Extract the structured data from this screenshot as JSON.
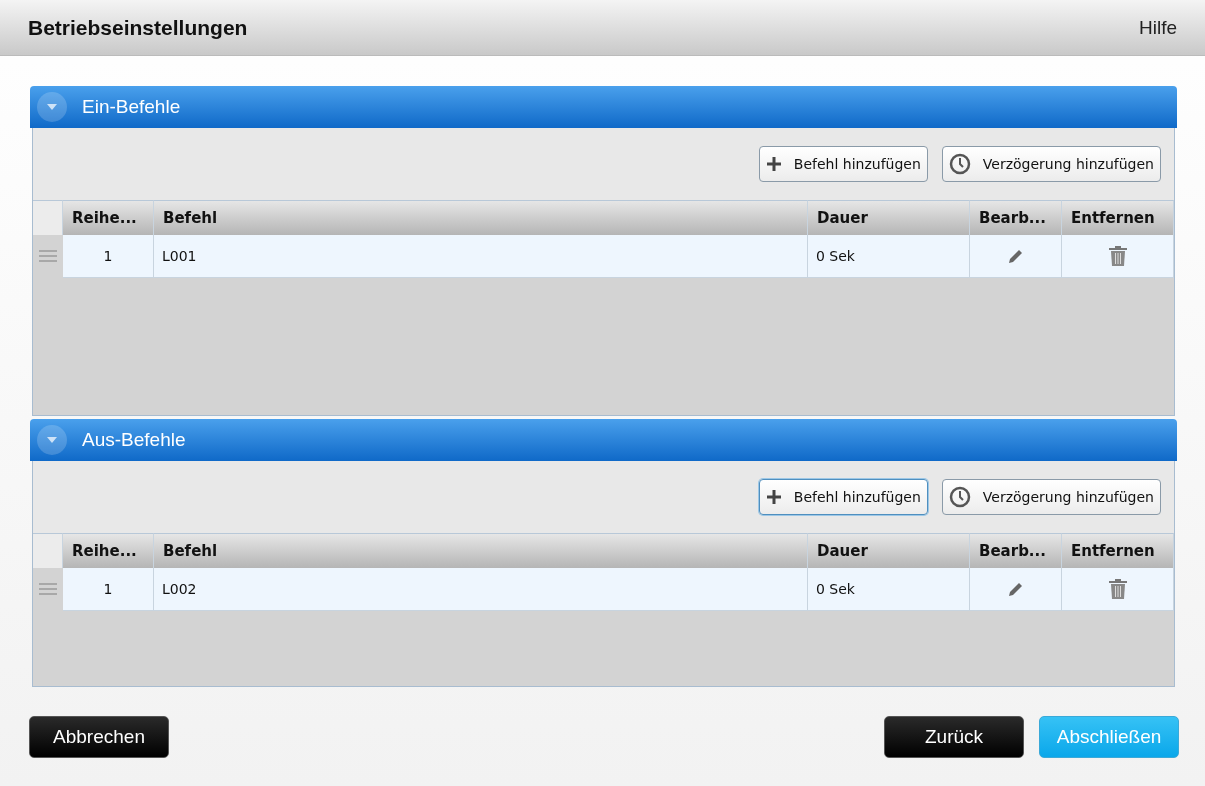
{
  "window": {
    "title": "Betriebseinstellungen",
    "help": "Hilfe"
  },
  "sections": [
    {
      "title": "Ein-Befehle",
      "expanded": true,
      "buttons": [
        {
          "kind": "add",
          "label": "Befehl hinzufügen",
          "focused": false
        },
        {
          "kind": "delay",
          "label": "Verzögerung hinzufügen",
          "focused": false
        }
      ],
      "columns": [
        "Reihe...",
        "Befehl",
        "Dauer",
        "Bearb...",
        "Entfernen"
      ],
      "rows": [
        {
          "order": "1",
          "command": "L001",
          "duration": "0 Sek"
        }
      ]
    },
    {
      "title": "Aus-Befehle",
      "expanded": true,
      "buttons": [
        {
          "kind": "add",
          "label": "Befehl hinzufügen",
          "focused": true
        },
        {
          "kind": "delay",
          "label": "Verzögerung hinzufügen",
          "focused": false
        }
      ],
      "columns": [
        "Reihe...",
        "Befehl",
        "Dauer",
        "Bearb...",
        "Entfernen"
      ],
      "rows": [
        {
          "order": "1",
          "command": "L002",
          "duration": "0 Sek"
        }
      ]
    }
  ],
  "footer": [
    {
      "kind": "dark",
      "label": "Abbrechen"
    },
    {
      "kind": "spacer"
    },
    {
      "kind": "dark",
      "label": "Zurück"
    },
    {
      "kind": "primary",
      "label": "Abschließen"
    }
  ]
}
